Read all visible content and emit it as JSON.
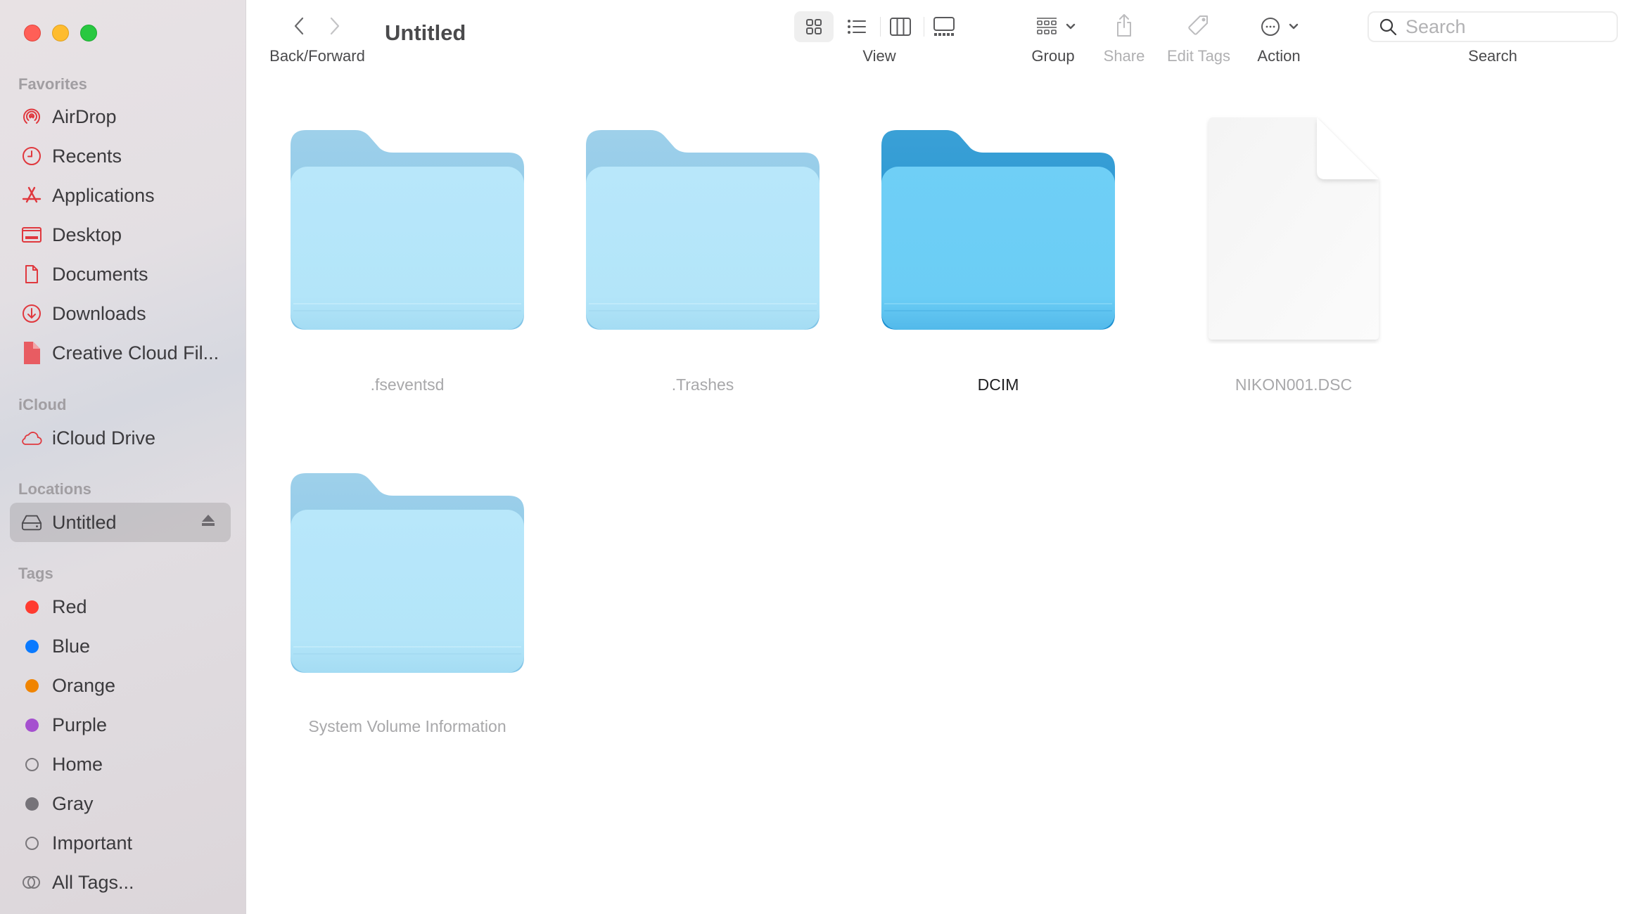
{
  "window": {
    "title": "Untitled",
    "traffic_lights": [
      {
        "name": "close",
        "color": "#ff5f57"
      },
      {
        "name": "minimize",
        "color": "#febc2e"
      },
      {
        "name": "zoom",
        "color": "#28c840"
      }
    ]
  },
  "toolbar": {
    "back_forward_label": "Back/Forward",
    "view_label": "View",
    "view_modes": [
      "icons",
      "list",
      "columns",
      "gallery"
    ],
    "active_view": "icons",
    "group_label": "Group",
    "share_label": "Share",
    "edit_tags_label": "Edit Tags",
    "action_label": "Action",
    "search_label": "Search",
    "search_placeholder": "Search",
    "search_value": ""
  },
  "sidebar": {
    "favorites_header": "Favorites",
    "favorites": [
      {
        "label": "AirDrop",
        "icon": "airdrop-icon"
      },
      {
        "label": "Recents",
        "icon": "clock-icon"
      },
      {
        "label": "Applications",
        "icon": "applications-icon"
      },
      {
        "label": "Desktop",
        "icon": "desktop-icon"
      },
      {
        "label": "Documents",
        "icon": "document-icon"
      },
      {
        "label": "Downloads",
        "icon": "download-icon"
      },
      {
        "label": "Creative Cloud Fil...",
        "icon": "creative-cloud-file-icon"
      }
    ],
    "icloud_header": "iCloud",
    "icloud": [
      {
        "label": "iCloud Drive",
        "icon": "cloud-icon"
      }
    ],
    "locations_header": "Locations",
    "locations": [
      {
        "label": "Untitled",
        "icon": "drive-icon",
        "selected": true,
        "ejectable": true
      }
    ],
    "tags_header": "Tags",
    "tags": [
      {
        "label": "Red",
        "color": "#ff3b30",
        "style": "filled"
      },
      {
        "label": "Blue",
        "color": "#0a7aff",
        "style": "filled"
      },
      {
        "label": "Orange",
        "color": "#f08400",
        "style": "filled"
      },
      {
        "label": "Purple",
        "color": "#a550cf",
        "style": "filled"
      },
      {
        "label": "Home",
        "color": "#7a777b",
        "style": "outline"
      },
      {
        "label": "Gray",
        "color": "#767379",
        "style": "filled"
      },
      {
        "label": "Important",
        "color": "#7a777b",
        "style": "outline"
      },
      {
        "label": "All Tags...",
        "color": "#7a777b",
        "style": "all-tags"
      }
    ]
  },
  "content": {
    "items": [
      {
        "name": ".fseventsd",
        "type": "folder",
        "hidden": true
      },
      {
        "name": ".Trashes",
        "type": "folder",
        "hidden": true
      },
      {
        "name": "DCIM",
        "type": "folder",
        "hidden": false
      },
      {
        "name": "NIKON001.DSC",
        "type": "file",
        "hidden": true
      },
      {
        "name": "System Volume Information",
        "type": "folder",
        "hidden": true
      }
    ]
  },
  "colors": {
    "sidebar_icon_accent": "#e0383e",
    "folder_normal": "#6ccff6",
    "folder_hidden": "#b6e6f9"
  }
}
